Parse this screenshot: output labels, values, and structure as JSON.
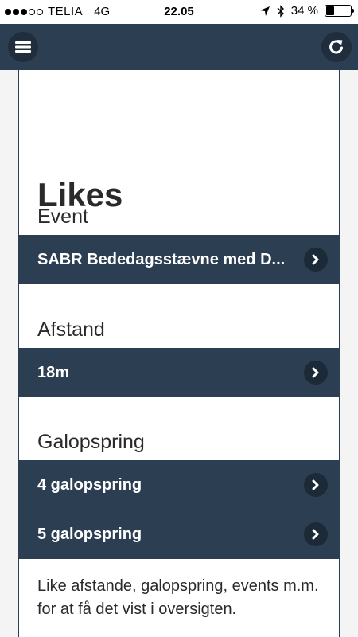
{
  "status_bar": {
    "carrier": "TELIA",
    "network": "4G",
    "time": "22.05",
    "battery_text": "34 %",
    "battery_level": 0.34,
    "signal_bars_filled": 3,
    "signal_bars_total": 5
  },
  "app_bar": {
    "menu_icon": "hamburger-icon",
    "refresh_icon": "refresh-icon",
    "color": "#2c3e52"
  },
  "page": {
    "title": "Likes",
    "sections": [
      {
        "label": "Event",
        "items": [
          "SABR Bededagsstævne med D..."
        ]
      },
      {
        "label": "Afstand",
        "items": [
          "18m"
        ]
      },
      {
        "label": "Galopspring",
        "items": [
          "4 galopspring",
          "5 galopspring"
        ]
      }
    ],
    "footer_text": "Like afstande, galopspring, events m.m. for at få det vist i oversigten."
  }
}
